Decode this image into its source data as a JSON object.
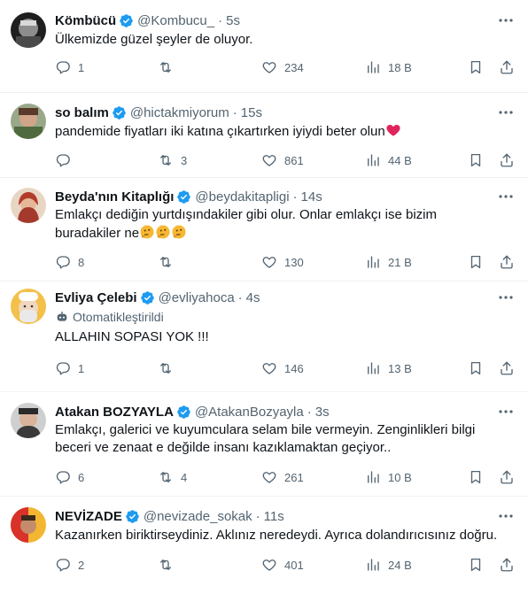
{
  "tweets": [
    {
      "name": "Kömbücü",
      "handle": "@Kombucu_",
      "time": "5s",
      "text": "Ülkemizde güzel şeyler de oluyor.",
      "reply": "1",
      "retweet": "",
      "like": "234",
      "views": "18 B",
      "avatar_color": "#2b2b2b"
    },
    {
      "name": "so balım",
      "handle": "@hictakmiyorum",
      "time": "15s",
      "text": "pandemide fiyatları iki katına çıkartırken iyiydi beter olun",
      "reply": "",
      "retweet": "3",
      "like": "861",
      "views": "44 B",
      "avatar_color": "#6b8a5b"
    },
    {
      "name": "Beyda'nın Kitaplığı",
      "handle": "@beydakitapligi",
      "time": "14s",
      "text_line1": "Emlakçı dediğin yurtdışındakiler gibi olur. Onlar emlakçı ise bizim",
      "text_line2": "buradakiler ne",
      "reply": "8",
      "retweet": "",
      "like": "130",
      "views": "21 B",
      "avatar_color": "#b64a3a"
    },
    {
      "name": "Evliya Çelebi",
      "handle": "@evliyahoca",
      "time": "4s",
      "automated": "Otomatikleştirildi",
      "text": "ALLAHIN SOPASI YOK !!!",
      "reply": "1",
      "retweet": "",
      "like": "146",
      "views": "13 B",
      "avatar_color": "#e8a53a"
    },
    {
      "name": "Atakan BOZYAYLA",
      "handle": "@AtakanBozyayla",
      "time": "3s",
      "text_line1": "Emlakçı, galerici ve kuyumculara selam bile vermeyin. Zenginlikleri bilgi",
      "text_line2": "beceri ve zenaat e değilde insanı kazıklamaktan geçiyor..",
      "reply": "6",
      "retweet": "4",
      "like": "261",
      "views": "10 B",
      "avatar_color": "#a9a9a9"
    },
    {
      "name": "NEVİZADE",
      "handle": "@nevizade_sokak",
      "time": "11s",
      "text": "Kazanırken biriktirseydiniz. Aklınız neredeydi. Ayrıca dolandırıcısınız doğru.",
      "reply": "2",
      "retweet": "",
      "like": "401",
      "views": "24 B",
      "avatar_color": "#d8322a"
    }
  ],
  "colors": {
    "verified": "#1d9bf0",
    "secondary": "#536471",
    "text": "#0f1419",
    "heart_emoji": "#e0245e",
    "thinking_emoji": "#f7b731"
  },
  "icons": [
    "reply-icon",
    "retweet-icon",
    "like-icon",
    "views-icon",
    "bookmark-icon",
    "share-icon",
    "more-icon",
    "verified-badge-icon",
    "robot-icon"
  ]
}
